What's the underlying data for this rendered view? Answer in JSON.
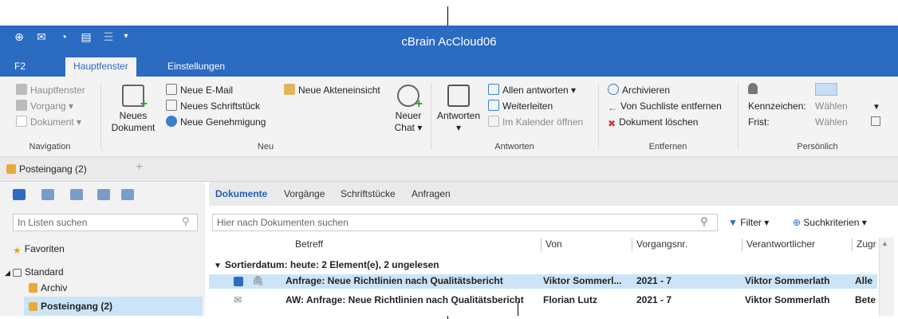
{
  "window": {
    "title": "cBrain AcCloud06"
  },
  "ribbon_tabs": [
    {
      "label": "F2"
    },
    {
      "label": "Hauptfenster"
    },
    {
      "label": "Einstellungen"
    }
  ],
  "ribbon": {
    "navigation": {
      "hauptfenster": "Hauptfenster",
      "vorgang": "Vorgang ▾",
      "dokument": "Dokument ▾",
      "group": "Navigation"
    },
    "neu": {
      "neues_dokument_l1": "Neues",
      "neues_dokument_l2": "Dokument",
      "neue_email": "Neue E-Mail",
      "neues_schriftstueck": "Neues Schriftstück",
      "neue_genehmigung": "Neue Genehmigung",
      "neue_akteneinsicht": "Neue Akteneinsicht",
      "neuer_chat_l1": "Neuer",
      "neuer_chat_l2": "Chat ▾",
      "group": "Neu"
    },
    "antworten": {
      "antworten_l1": "Antworten",
      "antworten_l2": "▾",
      "allen_antworten": "Allen antworten ▾",
      "weiterleiten": "Weiterleiten",
      "im_kalender": "Im Kalender öffnen",
      "group": "Antworten"
    },
    "entfernen": {
      "archivieren": "Archivieren",
      "von_suchliste": "Von Suchliste entfernen",
      "dokument_loeschen": "Dokument löschen",
      "group": "Entfernen"
    },
    "persoenlich": {
      "kennzeichen": "Kennzeichen:",
      "kennzeichen_value": "Wählen",
      "frist": "Frist:",
      "frist_value": "Wählen",
      "group": "Persönlich"
    }
  },
  "doc_tabs": [
    {
      "label": "Posteingang (2)"
    }
  ],
  "sidebar": {
    "search_placeholder": "In Listen suchen",
    "favoriten": "Favoriten",
    "standard": "Standard",
    "archiv": "Archiv",
    "posteingang": "Posteingang (2)"
  },
  "main": {
    "subtabs": [
      {
        "label": "Dokumente"
      },
      {
        "label": "Vorgänge"
      },
      {
        "label": "Schriftstücke"
      },
      {
        "label": "Anfragen"
      }
    ],
    "search_placeholder": "Hier nach Dokumenten suchen",
    "filter_label": "Filter ▾",
    "suchkriterien_label": "Suchkriterien ▾",
    "columns": [
      "Betreff",
      "Von",
      "Vorgangsnr.",
      "Verantwortlicher",
      "Zugr"
    ],
    "group_header": "Sortierdatum: heute: 2 Element(e), 2 ungelesen",
    "rows": [
      {
        "betreff": "Anfrage: Neue Richtlinien nach Qualitätsbericht",
        "von": "Viktor Sommerl...",
        "vorgangsnr": "2021 - 7",
        "verantwortlicher": "Viktor Sommerlath",
        "zugriff": "Alle"
      },
      {
        "betreff": "AW: Anfrage: Neue Richtlinien nach Qualitätsbericht",
        "von": "Florian Lutz",
        "vorgangsnr": "2021 - 7",
        "verantwortlicher": "Viktor Sommerlath",
        "zugriff": "Bete"
      }
    ]
  },
  "colors": {
    "accent": "#2b6bc2",
    "selected_row": "#cce4f7"
  }
}
